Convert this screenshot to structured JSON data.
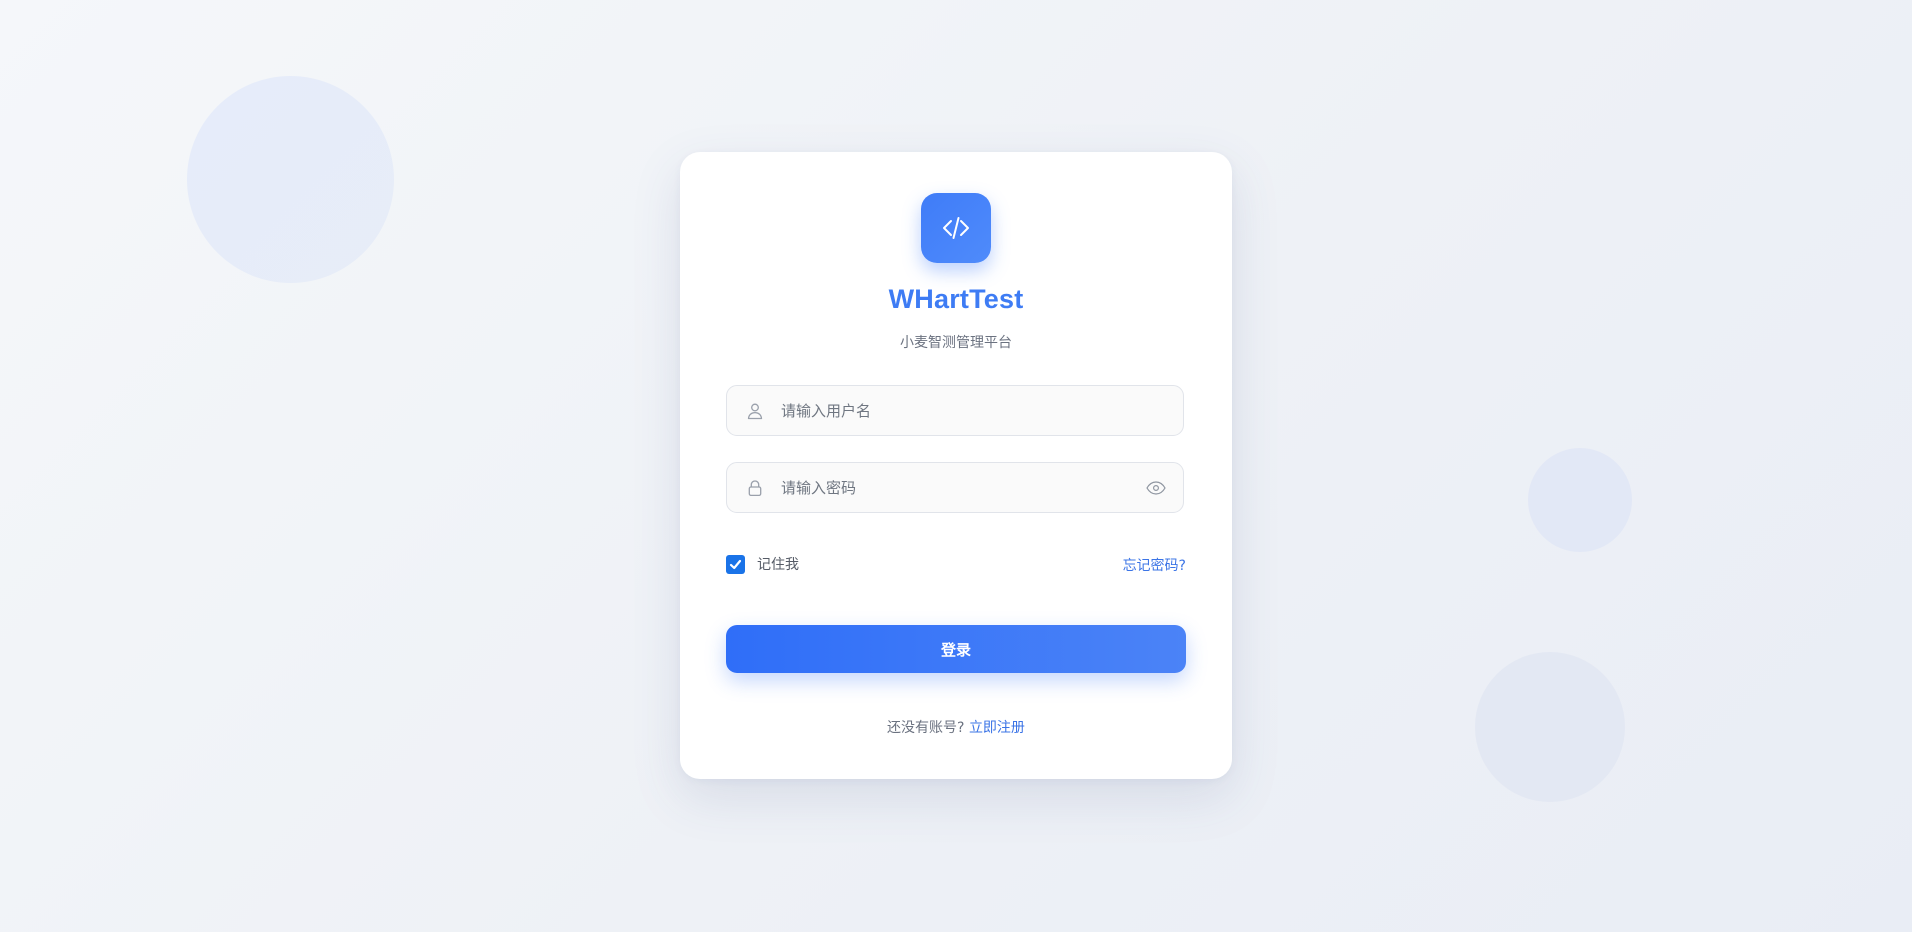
{
  "app": {
    "title": "WHartTest",
    "subtitle": "小麦智测管理平台",
    "logo_icon": "code-icon",
    "accent_color": "#3e7cf4"
  },
  "form": {
    "username": {
      "placeholder": "请输入用户名",
      "value": "",
      "icon": "user-icon"
    },
    "password": {
      "placeholder": "请输入密码",
      "value": "",
      "icon": "lock-icon",
      "toggle_icon": "eye-icon"
    },
    "remember": {
      "label": "记住我",
      "checked": true
    },
    "forgot_label": "忘记密码?",
    "submit_label": "登录"
  },
  "footer": {
    "prompt": "还没有账号?",
    "register_label": "立即注册"
  }
}
